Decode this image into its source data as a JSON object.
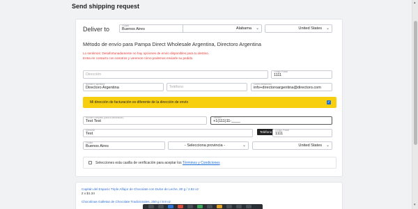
{
  "page": {
    "title": "Send shipping request"
  },
  "deliver": {
    "label": "Deliver to",
    "city_label": "Ciudad",
    "city_value": "Buenos Aires",
    "state_value": "Alabama",
    "country_value": "United States"
  },
  "method": {
    "title": "Método de envío para Pampa Direct Wholesale Argentina, Directoro Argentina",
    "warning_line1": "Lo sentimos: Desafortunadamente no hay opciones de envío disponibles para tu destino.",
    "warning_line2": "Entra en contacto con nosotros y veremos cómo podemos enviarle su pedido."
  },
  "shipping_form": {
    "address_placeholder": "Dirección",
    "postal_label": "Código Postal",
    "postal_value": "1111",
    "name_label": "Nombre y apellidos",
    "name_value": "Directoro Argentina",
    "phone_placeholder": "Teléfono",
    "email_label": "Correo electrónico",
    "email_value": "info+directoroargentina@directoro.com"
  },
  "billing": {
    "checkbox_label": "Mi dirección de facturación es diferente de la dirección de envío",
    "checked": true,
    "name_label": "Nombre completo (para la facturación)",
    "name_value": "Test Test",
    "phone_label": "Teléfono",
    "phone_value": "+1(111)11-____",
    "tooltip": "Teléfono",
    "address_label": "Dirección",
    "address_value": "Test",
    "postal_label": "Código Postal",
    "postal_value": "1111",
    "city_label": "Ciudad",
    "city_value": "Buenos Aires",
    "province_value": "- Selecciona provincia -",
    "country_value": "United States"
  },
  "terms": {
    "text": "Selecciones esta casilla de verificación para aceptar los",
    "link": "Términos y Condiciones"
  },
  "products": [
    {
      "name": "Capitán del Espacio Triple Alfajor de Chocolate con Dulce de Leche, 80 g / 2.82 oz",
      "qty": "2 x $1.34"
    },
    {
      "name": "Chocolinas Galletas de Chocolate Tradicionales, 250 g / 8.8 oz",
      "qty": ""
    }
  ],
  "colors": {
    "accent": "#f7cf0f",
    "link": "#1e6fd9",
    "warning": "#e53935"
  },
  "icons": {
    "dropdown": "chevron-down-icon",
    "checkbox": "checkbox-icon"
  }
}
